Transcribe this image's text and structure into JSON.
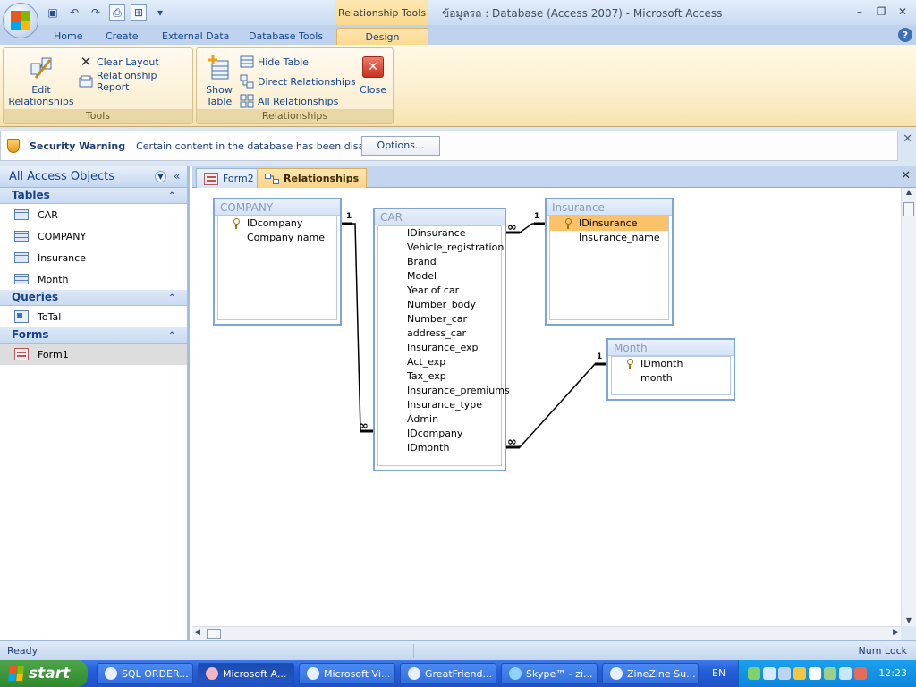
{
  "window": {
    "title": "ข้อมูลรถ : Database (Access 2007) - Microsoft Access",
    "contextual_tab": "Relationship Tools"
  },
  "ribbon_tabs": [
    "Home",
    "Create",
    "External Data",
    "Database Tools",
    "Design"
  ],
  "ribbon": {
    "tools_group": {
      "label": "Tools",
      "edit_relationships": "Edit\nRelationships",
      "clear_layout": "Clear Layout",
      "relationship_report": "Relationship Report"
    },
    "relationships_group": {
      "label": "Relationships",
      "show_table": "Show\nTable",
      "hide_table": "Hide Table",
      "direct_relationships": "Direct Relationships",
      "all_relationships": "All Relationships",
      "close": "Close"
    }
  },
  "security_bar": {
    "title": "Security Warning",
    "message": "Certain content in the database has been disabled",
    "options_label": "Options..."
  },
  "nav_pane": {
    "title": "All Access Objects",
    "sections": {
      "tables": {
        "label": "Tables",
        "items": [
          "CAR",
          "COMPANY",
          "Insurance",
          "Month"
        ]
      },
      "queries": {
        "label": "Queries",
        "items": [
          "ToTal"
        ]
      },
      "forms": {
        "label": "Forms",
        "items": [
          "Form1"
        ]
      }
    }
  },
  "doc_tabs": [
    "Form2",
    "Relationships"
  ],
  "tables": {
    "company": {
      "name": "COMPANY",
      "fields": [
        "IDcompany",
        "Company name"
      ]
    },
    "car": {
      "name": "CAR",
      "fields": [
        "IDinsurance",
        "Vehicle_registration",
        "Brand",
        "Model",
        "Year of car",
        "Number_body",
        "Number_car",
        "address_car",
        "Insurance_exp",
        "Act_exp",
        "Tax_exp",
        "Insurance_premiums",
        "Insurance_type",
        "Admin",
        "IDcompany",
        "IDmonth"
      ]
    },
    "insurance": {
      "name": "Insurance",
      "fields": [
        "IDinsurance",
        "Insurance_name"
      ]
    },
    "month": {
      "name": "Month",
      "fields": [
        "IDmonth",
        "month"
      ]
    }
  },
  "relationships": {
    "one": "1",
    "many": "∞"
  },
  "status_bar": {
    "left": "Ready",
    "right": "Num Lock"
  },
  "taskbar": {
    "start": "start",
    "tasks": [
      "SQL ORDER...",
      "Microsoft A...",
      "Microsoft Vi...",
      "GreatFriend...",
      "Skype™ - zi...",
      "ZineZine Su..."
    ],
    "language": "EN",
    "clock": "12:23"
  }
}
